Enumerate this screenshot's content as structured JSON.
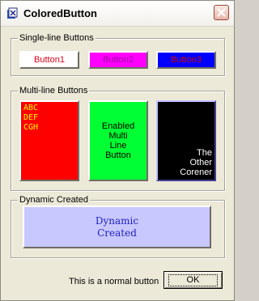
{
  "window": {
    "title": "ColoredButton"
  },
  "groups": {
    "single": {
      "label": "Single-line Buttons",
      "buttons": [
        {
          "label": "Button1",
          "bg": "#ffffff",
          "fg": "#e0001a"
        },
        {
          "label": "Button2",
          "bg": "#ff00ff",
          "fg": "#a000a0"
        },
        {
          "label": "Button3",
          "bg": "#0000ff",
          "fg": "#d00000"
        }
      ]
    },
    "multi": {
      "label": "Multi-line Buttons",
      "buttons": [
        {
          "lines": [
            "ABC",
            "DEF",
            "CGH"
          ],
          "bg": "#ff0000",
          "fg": "#ffff00",
          "align": "top-left"
        },
        {
          "lines": [
            "Enabled",
            "Multi",
            "Line",
            "Button"
          ],
          "bg": "#00ff33",
          "fg": "#000000",
          "align": "center"
        },
        {
          "lines": [
            "The",
            "Other",
            "Corener"
          ],
          "bg": "#000000",
          "fg": "#ffffff",
          "align": "bottom-right"
        }
      ]
    },
    "dynamic": {
      "label": "Dynamic Created",
      "button": {
        "lines": [
          "Dynamic",
          "Created"
        ],
        "bg": "#c8c8ff",
        "fg": "#2020c0"
      }
    }
  },
  "footer": {
    "normal_text": "This is a normal button",
    "ok_label": "OK"
  },
  "colors": {
    "window_bg": "#ece9d8",
    "close_x": "#ffffff"
  }
}
